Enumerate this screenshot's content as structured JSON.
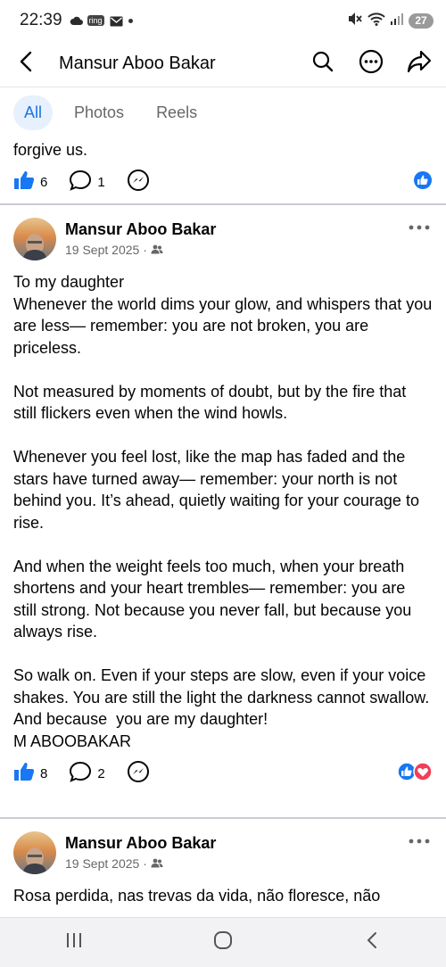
{
  "status_bar": {
    "time": "22:39",
    "ring_label": "ring",
    "battery": "27"
  },
  "header": {
    "title": "Mansur Aboo Bakar"
  },
  "tabs": [
    {
      "label": "All",
      "active": true
    },
    {
      "label": "Photos",
      "active": false
    },
    {
      "label": "Reels",
      "active": false
    }
  ],
  "posts": [
    {
      "text": "forgive us.",
      "likes": "6",
      "comments": "1"
    },
    {
      "author": "Mansur Aboo Bakar",
      "date": "19 Sept 2025",
      "separator": "·",
      "text": "To my daughter\nWhenever the world dims your glow, and whispers that you are less— remember: you are not broken, you are priceless.\n\nNot measured by moments of doubt, but by the fire that still flickers even when the wind howls.\n\nWhenever you feel lost, like the map has faded and the stars have turned away— remember: your north is not behind you. It’s ahead, quietly waiting for your courage to rise.\n\nAnd when the weight feels too much, when your breath shortens and your heart trembles— remember: you are still strong. Not because you never fall, but because you always rise.\n\nSo walk on. Even if your steps are slow, even if your voice shakes. You are still the light the darkness cannot swallow.\nAnd because  you are my daughter!\nM ABOOBAKAR",
      "likes": "8",
      "comments": "2"
    },
    {
      "author": "Mansur Aboo Bakar",
      "date": "19 Sept 2025",
      "separator": "·",
      "text": "Rosa perdida, nas trevas da vida, não floresce, não"
    }
  ],
  "colors": {
    "accent": "#1b74e4",
    "like_blue": "#1877f2",
    "love_red": "#f33e58"
  },
  "icons": [
    "back-arrow-icon",
    "search-icon",
    "more-circle-icon",
    "share-icon",
    "like-thumb-icon",
    "comment-icon",
    "messenger-icon",
    "audience-friends-icon",
    "love-reaction-icon"
  ]
}
